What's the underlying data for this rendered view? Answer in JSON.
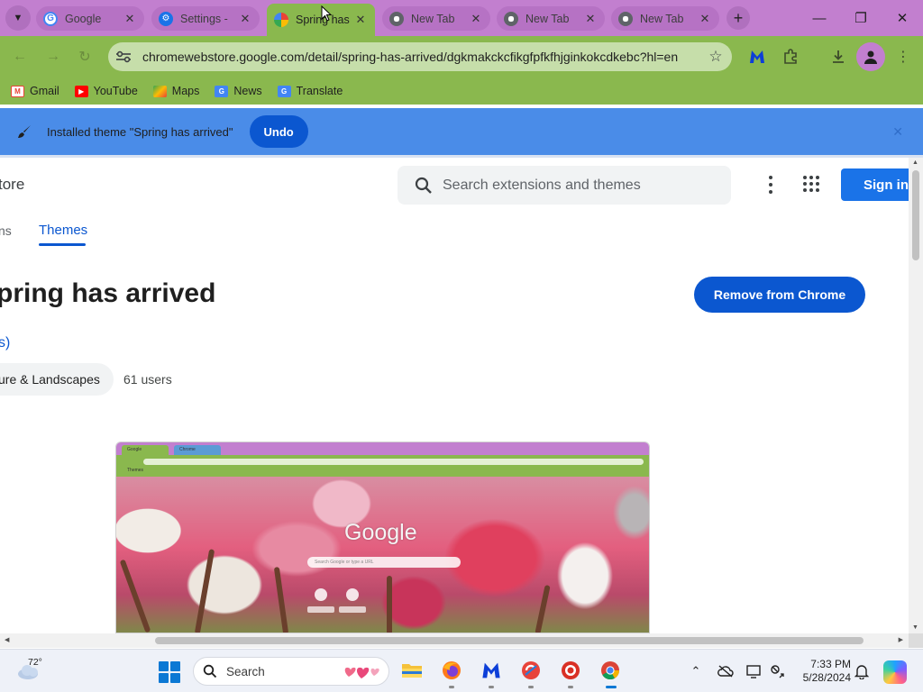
{
  "browser": {
    "tabs": [
      {
        "title": "Google",
        "favicon": "google-icon",
        "active": false
      },
      {
        "title": "Settings -",
        "favicon": "settings-icon",
        "active": false
      },
      {
        "title": "Spring has",
        "favicon": "webstore-icon",
        "active": true
      },
      {
        "title": "New Tab",
        "favicon": "chrome-icon",
        "active": false
      },
      {
        "title": "New Tab",
        "favicon": "chrome-icon",
        "active": false
      },
      {
        "title": "New Tab",
        "favicon": "chrome-icon",
        "active": false
      }
    ],
    "omnibox_url": "chromewebstore.google.com/detail/spring-has-arrived/dgkmakckcfikgfpfkfhjginkokcdkebc?hl=en",
    "bookmarks": [
      {
        "label": "Gmail",
        "icon": "gmail-icon"
      },
      {
        "label": "YouTube",
        "icon": "youtube-icon"
      },
      {
        "label": "Maps",
        "icon": "maps-icon"
      },
      {
        "label": "News",
        "icon": "news-icon"
      },
      {
        "label": "Translate",
        "icon": "translate-icon"
      }
    ],
    "infobar": {
      "message": "Installed theme \"Spring has arrived\"",
      "undo_label": "Undo"
    },
    "theme_colors": {
      "tabstrip": "#c27fcf",
      "toolbar": "#8ab84e",
      "infobar": "#4a8ce8"
    }
  },
  "store": {
    "header_fragment": "tore",
    "search_placeholder": "Search extensions and themes",
    "signin_label": "Sign in",
    "nav_fragment": "ns",
    "nav_active": "Themes",
    "item_title": "pring has arrived",
    "remove_label": "Remove from Chrome",
    "link_fragment": "s)",
    "category_chip": "ure & Landscapes",
    "users": "61 users",
    "preview": {
      "tab1": "Google",
      "tab2": "Chrome",
      "bookmark": "Themes",
      "logo": "Google",
      "search_hint": "Search Google or type a URL"
    }
  },
  "taskbar": {
    "weather_temp": "72°",
    "search_label": "Search",
    "apps": [
      "file-explorer-icon",
      "firefox-icon",
      "malwarebytes-icon",
      "ccleaner-icon",
      "recorder-icon",
      "chrome-icon"
    ],
    "time": "7:33 PM",
    "date": "5/28/2024"
  }
}
